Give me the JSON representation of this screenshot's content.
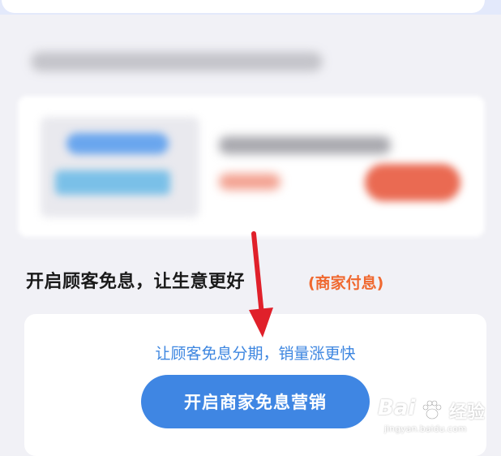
{
  "section": {
    "heading": "开启顾客免息，让生意更好",
    "heading_tag": "(商家付息)"
  },
  "promo": {
    "description": "让顾客免息分期，销量涨更快",
    "button_label": "开启商家免息营销"
  },
  "watermark": {
    "logo": "Bai",
    "brand": "经验",
    "url": "jingyan.baidu.com"
  },
  "colors": {
    "accent_blue": "#3f86e3",
    "tag_orange": "#f0682f",
    "annotation_red": "#e0202a",
    "background": "#f1f1f6"
  }
}
